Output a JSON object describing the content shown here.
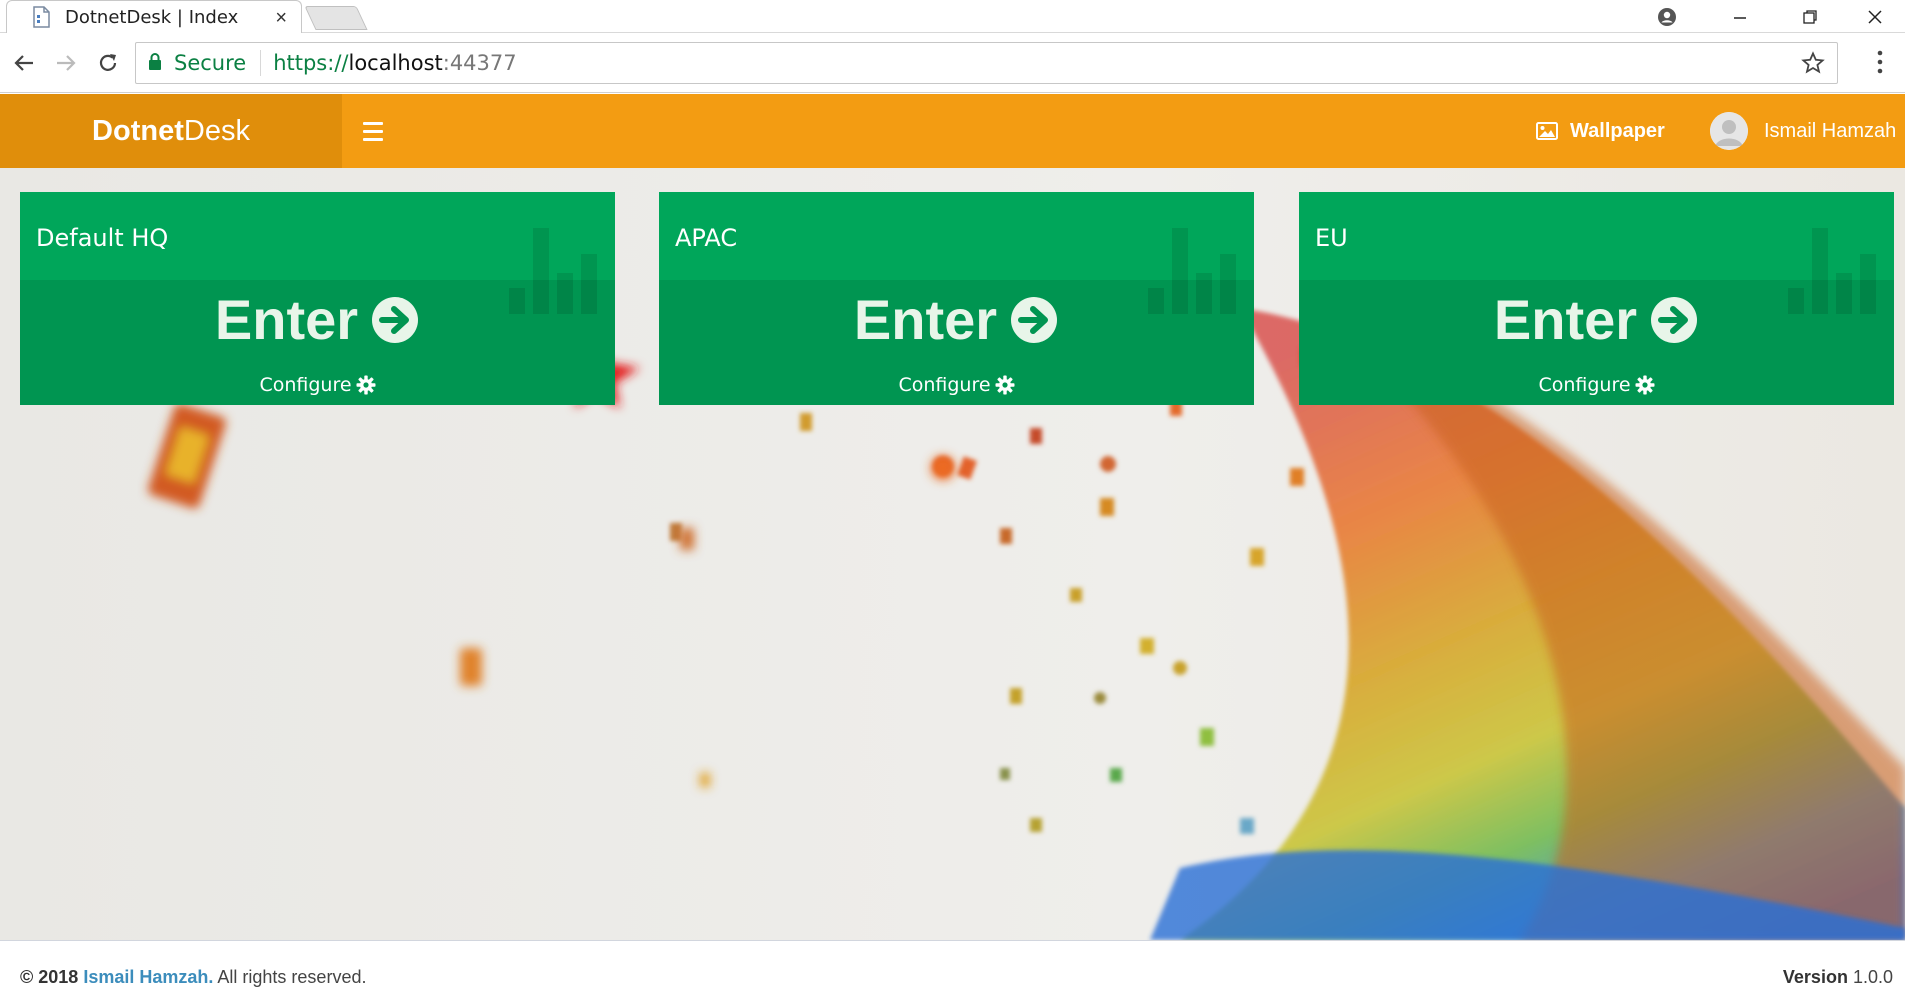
{
  "browser": {
    "tab_title": "DotnetDesk | Index",
    "tab_close": "×",
    "secure_label": "Secure",
    "url_protocol": "https://",
    "url_host": "localhost",
    "url_port": ":44377",
    "secure_color": "#0b8043"
  },
  "header": {
    "brand_bold": "Dotnet",
    "brand_light": "Desk",
    "wallpaper_label": "Wallpaper",
    "user_name": "Ismail Hamzah",
    "accent_color": "#f39c12",
    "brand_bg_color": "#e08e0b"
  },
  "workspaces": [
    {
      "title": "Default HQ",
      "enter_label": "Enter",
      "configure_label": "Configure"
    },
    {
      "title": "APAC",
      "enter_label": "Enter",
      "configure_label": "Configure"
    },
    {
      "title": "EU",
      "enter_label": "Enter",
      "configure_label": "Configure"
    }
  ],
  "card_color": "#00a65a",
  "footer": {
    "copyright_prefix": "© 2018",
    "author": "Ismail Hamzah.",
    "rights": "All rights reserved.",
    "version_label": "Version",
    "version_value": "1.0.0"
  }
}
